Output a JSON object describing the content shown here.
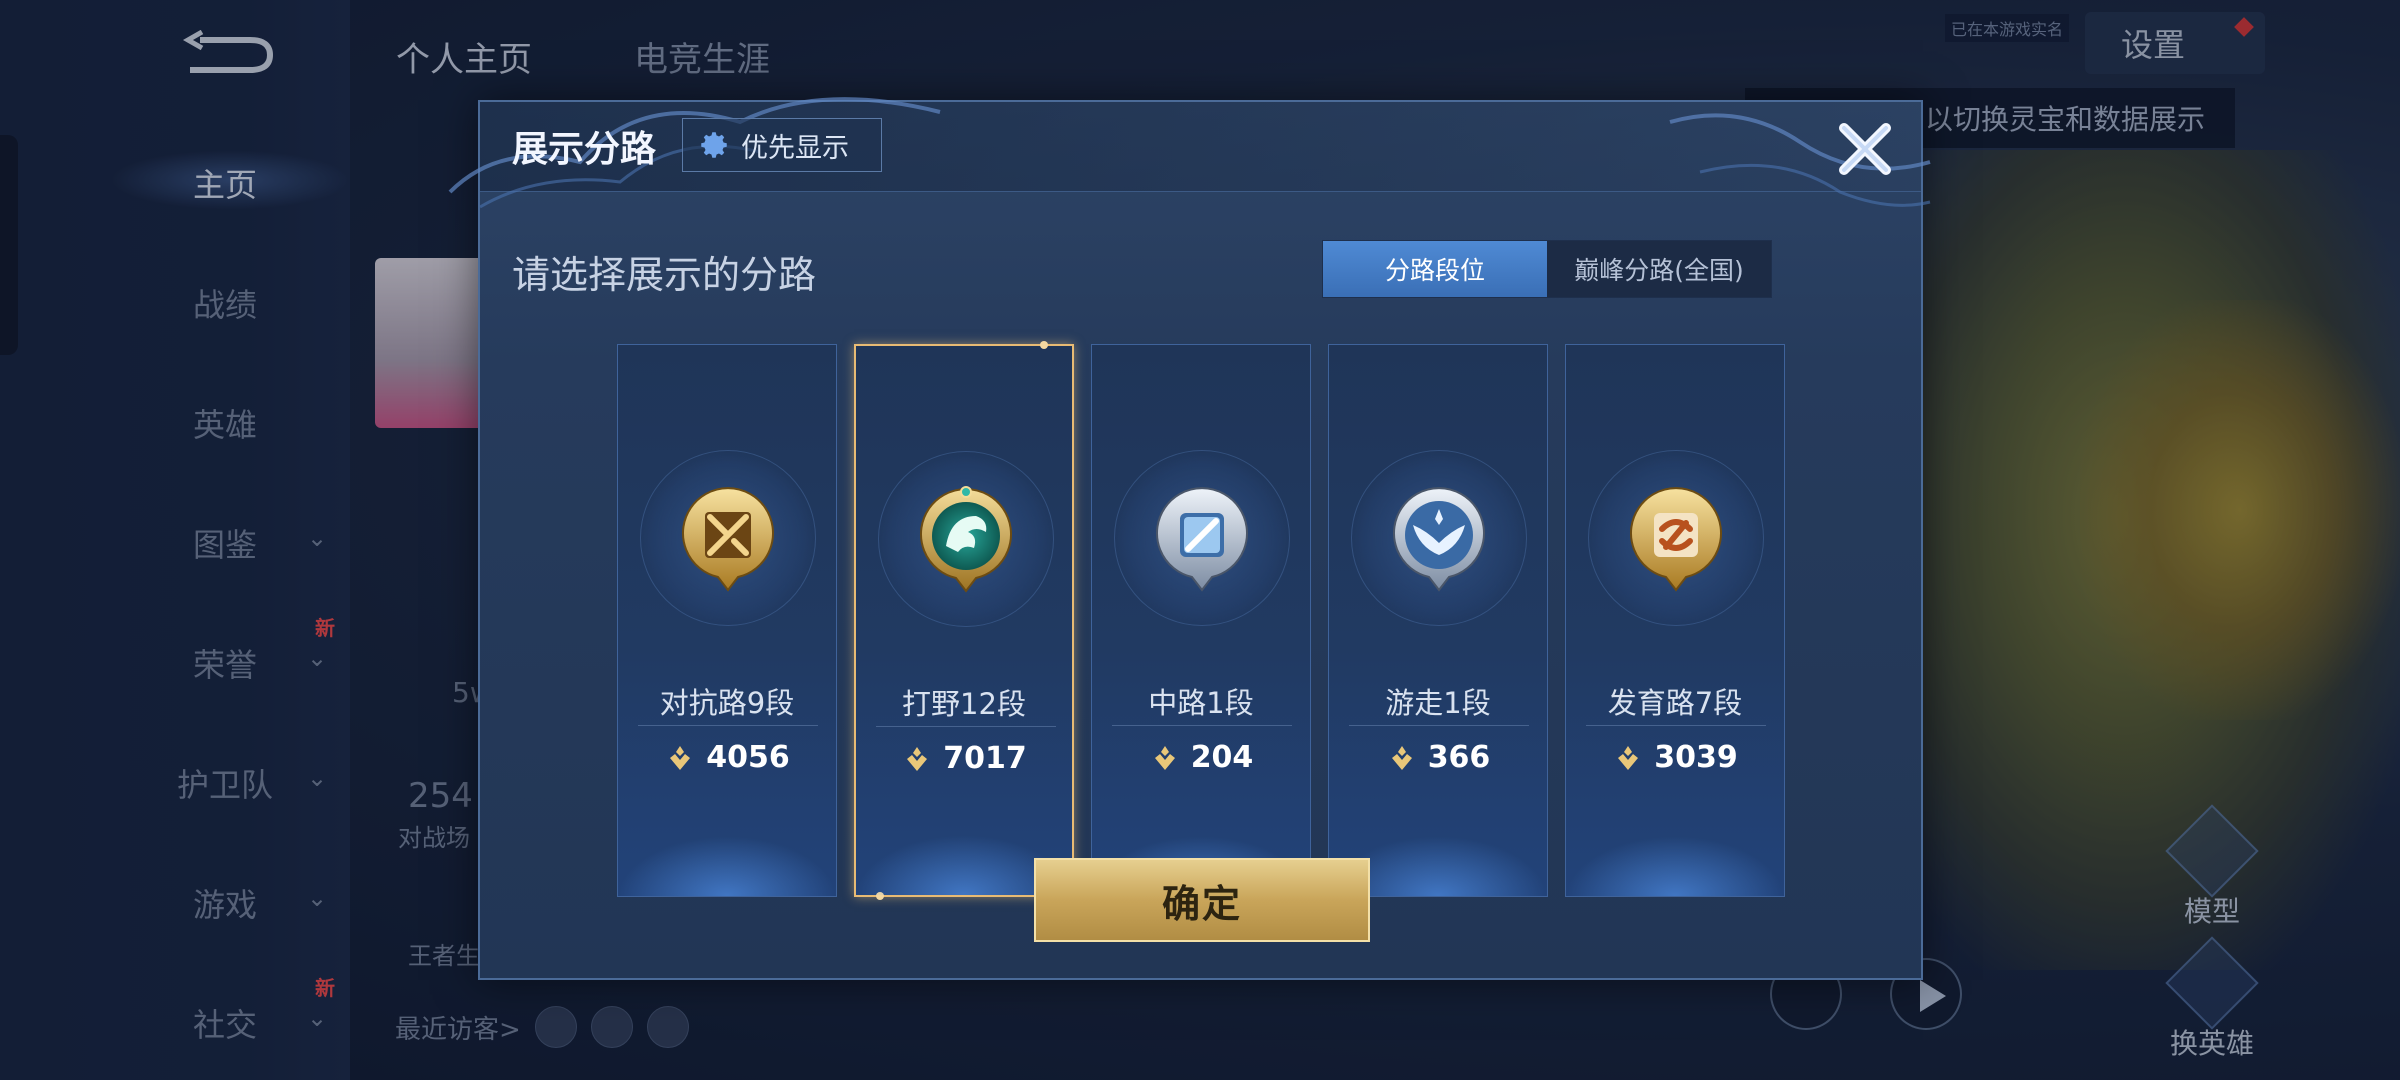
{
  "background": {
    "sidebar": {
      "items": [
        {
          "label": "主页",
          "active": true
        },
        {
          "label": "战绩"
        },
        {
          "label": "英雄"
        },
        {
          "label": "图鉴",
          "chevron": true
        },
        {
          "label": "荣誉",
          "chevron": true,
          "badge": "新"
        },
        {
          "label": "护卫队",
          "chevron": true
        },
        {
          "label": "游戏",
          "chevron": true
        },
        {
          "label": "社交",
          "chevron": true,
          "badge": "新"
        }
      ]
    },
    "top_tabs": [
      "个人主页",
      "电竞生涯"
    ],
    "settings_label": "设置",
    "small_label": "已在本游戏实名",
    "tip_text": "以切换灵宝和数据展示",
    "middle": {
      "count": "254",
      "count_label": "对战场",
      "partial_5w": "5w",
      "partial_king": "王者生"
    },
    "visitors_label": "最近访客>",
    "right_buttons": [
      "模型",
      "换英雄"
    ]
  },
  "modal": {
    "title": "展示分路",
    "priority_button": "优先显示",
    "subtitle": "请选择展示的分路",
    "toggle": {
      "options": [
        "分路段位",
        "巅峰分路(全国)"
      ],
      "selected": 0
    },
    "lanes": [
      {
        "name": "对抗路9段",
        "score": "4056",
        "icon": "sword-badge-icon",
        "color": "gold"
      },
      {
        "name": "打野12段",
        "score": "7017",
        "icon": "dragon-badge-icon",
        "color": "jade",
        "selected": true
      },
      {
        "name": "中路1段",
        "score": "204",
        "icon": "wand-badge-icon",
        "color": "silver"
      },
      {
        "name": "游走1段",
        "score": "366",
        "icon": "wings-badge-icon",
        "color": "silver"
      },
      {
        "name": "发育路7段",
        "score": "3039",
        "icon": "arrow-badge-icon",
        "color": "gold"
      }
    ],
    "confirm_label": "确定",
    "accent_colors": {
      "selected_border": "#e8bb74",
      "toggle_active": "#4f8ad4",
      "confirm": "#c9a55a"
    }
  }
}
